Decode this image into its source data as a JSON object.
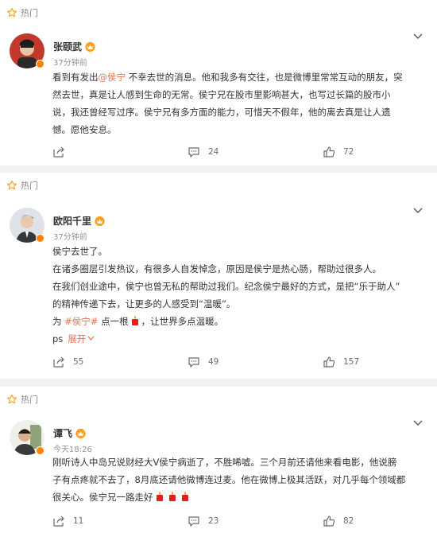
{
  "hot_label": "热门",
  "posts": [
    {
      "author": "张颐武",
      "time": "37分钟前",
      "lines": [
        [
          "看到有发出",
          "@侯宁",
          " 不幸去世的消息。他和我多有交往，也是微博里常常互动的朋友，突"
        ],
        [
          "然去世，真是让人感到生命的无常。侯宁兄在股市里影响甚大，也写过长篇的股市小"
        ],
        [
          "说，我还曾经写过序。侯宁兄有多方面的能力，可惜天不假年，他的离去真是让人遗"
        ],
        [
          "憾。愿他安息。"
        ]
      ],
      "share": "",
      "comments": "24",
      "likes": "72"
    },
    {
      "author": "欧阳千里",
      "time": "37分钟前",
      "lines": [
        "侯宁去世了。",
        "在诸多圈层引发热议，有很多人自发悼念，原因是侯宁是热心肠，帮助过很多人。",
        "在我们创业途中，侯宁也曾无私的帮助过我们。纪念侯宁最好的方式，是把“乐于助人”",
        "的精神传递下去，让更多的人感受到“温暖”。"
      ],
      "line5_prefix": "为 ",
      "topic": "#侯宁#",
      "line5_mid": " 点一根",
      "line5_suffix": "，让世界多点温暖。",
      "ps": "ps",
      "expand": "展开",
      "share": "55",
      "comments": "49",
      "likes": "157"
    },
    {
      "author": "谭飞",
      "time": "今天18:26",
      "lines": [
        "刚听诗人中岛兄说财经大V侯宁病逝了，不胜唏嘘。三个月前还请他来看电影，他说膀",
        "子有点疼就不去了，8月底还请他微博连过麦。他在微博上极其活跃，对几乎每个领域都",
        "很关心。侯宁兄一路走好"
      ],
      "share": "11",
      "comments": "23",
      "likes": "82"
    }
  ],
  "colors": {
    "accent": "#eb7350",
    "verified_badge": "#ff8200",
    "hot_star": "#f5a623"
  }
}
